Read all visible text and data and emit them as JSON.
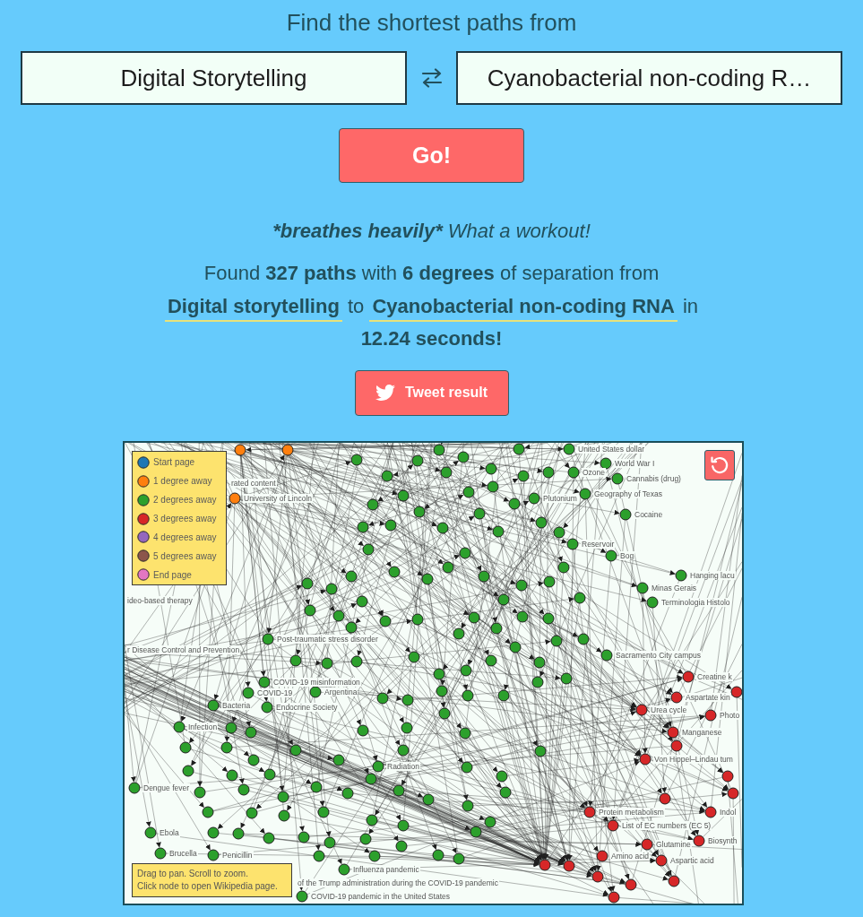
{
  "heading": "Find the shortest paths from",
  "search": {
    "source": {
      "value": "Digital Storytelling"
    },
    "target": {
      "value": "Cyanobacterial non-coding R…"
    }
  },
  "go_button": "Go!",
  "status": {
    "exclamation": "*breathes heavily*",
    "message": "What a workout!"
  },
  "result": {
    "intro": "Found **327 paths** with **6 degrees** of separation from",
    "source_link": "Digital storytelling",
    "joiner": "to",
    "target_link": "Cyanobacterial non-coding RNA",
    "outro": "in **12.24 seconds!**"
  },
  "tweet_button": "Tweet result",
  "graph": {
    "legend": [
      {
        "label": "Start page",
        "color": "#1f77b4"
      },
      {
        "label": "1 degree away",
        "color": "#ff7f0e"
      },
      {
        "label": "2 degrees away",
        "color": "#2ca02c"
      },
      {
        "label": "3 degrees away",
        "color": "#d62728"
      },
      {
        "label": "4 degrees away",
        "color": "#9467bd"
      },
      {
        "label": "5 degrees away",
        "color": "#8c564b"
      },
      {
        "label": "End page",
        "color": "#e377c2"
      }
    ],
    "cut_labels": [
      "rated content",
      "ideo-based therapy",
      "r Disease Control and Prevention",
      "of the Trump administration during the COVID-19 pandemic"
    ],
    "nodes": [
      {
        "color": "#ff7f0e"
      },
      {
        "color": "#ff7f0e"
      },
      {
        "label": "University of Lincoln",
        "color": "#ff7f0e"
      },
      {
        "label": "Post-traumatic stress disorder",
        "color": "#2ca02c"
      },
      {
        "label": "COVID-19 misinformation",
        "color": "#2ca02c"
      },
      {
        "label": "COVID-19",
        "color": "#2ca02c"
      },
      {
        "label": "Bacteria",
        "color": "#2ca02c"
      },
      {
        "label": "Endocrine Society",
        "color": "#2ca02c"
      },
      {
        "label": "Argentina",
        "color": "#2ca02c"
      },
      {
        "label": "Infection",
        "color": "#2ca02c"
      },
      {
        "label": "Dengue fever",
        "color": "#2ca02c"
      },
      {
        "label": "Ebola",
        "color": "#2ca02c"
      },
      {
        "label": "Brucella",
        "color": "#2ca02c"
      },
      {
        "label": "Penicillin",
        "color": "#2ca02c"
      },
      {
        "label": "Influenza pandemic",
        "color": "#2ca02c"
      },
      {
        "label": "COVID-19 pandemic in the United States",
        "color": "#2ca02c"
      },
      {
        "label": "United States dollar",
        "color": "#2ca02c"
      },
      {
        "label": "World War I",
        "color": "#2ca02c"
      },
      {
        "label": "Cannabis (drug)",
        "color": "#2ca02c"
      },
      {
        "label": "Geography of Texas",
        "color": "#2ca02c"
      },
      {
        "label": "Cocaine",
        "color": "#2ca02c"
      },
      {
        "label": "Plutonium",
        "color": "#2ca02c"
      },
      {
        "label": "Ozone",
        "color": "#2ca02c"
      },
      {
        "label": "Reservoir",
        "color": "#2ca02c"
      },
      {
        "label": "Bog",
        "color": "#2ca02c"
      },
      {
        "label": "Hanging lacu",
        "color": "#2ca02c"
      },
      {
        "label": "Minas Gerais",
        "color": "#2ca02c"
      },
      {
        "label": "Terminologia Histolo",
        "color": "#2ca02c"
      },
      {
        "label": "Sacramento City campus",
        "color": "#2ca02c"
      },
      {
        "label": "Radiation",
        "color": "#2ca02c"
      },
      {
        "color": "#2ca02c"
      },
      {
        "color": "#2ca02c"
      },
      {
        "color": "#2ca02c"
      },
      {
        "color": "#2ca02c"
      },
      {
        "color": "#2ca02c"
      },
      {
        "color": "#2ca02c"
      },
      {
        "color": "#2ca02c"
      },
      {
        "color": "#2ca02c"
      },
      {
        "color": "#2ca02c"
      },
      {
        "color": "#2ca02c"
      },
      {
        "color": "#2ca02c"
      },
      {
        "color": "#2ca02c"
      },
      {
        "color": "#2ca02c"
      },
      {
        "color": "#2ca02c"
      },
      {
        "color": "#2ca02c"
      },
      {
        "color": "#2ca02c"
      },
      {
        "color": "#2ca02c"
      },
      {
        "color": "#2ca02c"
      },
      {
        "color": "#2ca02c"
      },
      {
        "color": "#2ca02c"
      },
      {
        "color": "#2ca02c"
      },
      {
        "color": "#2ca02c"
      },
      {
        "color": "#2ca02c"
      },
      {
        "color": "#2ca02c"
      },
      {
        "color": "#2ca02c"
      },
      {
        "color": "#2ca02c"
      },
      {
        "color": "#2ca02c"
      },
      {
        "color": "#2ca02c"
      },
      {
        "color": "#2ca02c"
      },
      {
        "color": "#2ca02c"
      },
      {
        "color": "#2ca02c"
      },
      {
        "color": "#2ca02c"
      },
      {
        "color": "#2ca02c"
      },
      {
        "color": "#2ca02c"
      },
      {
        "color": "#2ca02c"
      },
      {
        "color": "#2ca02c"
      },
      {
        "color": "#2ca02c"
      },
      {
        "color": "#2ca02c"
      },
      {
        "color": "#2ca02c"
      },
      {
        "color": "#2ca02c"
      },
      {
        "color": "#2ca02c"
      },
      {
        "color": "#2ca02c"
      },
      {
        "color": "#2ca02c"
      },
      {
        "color": "#2ca02c"
      },
      {
        "color": "#2ca02c"
      },
      {
        "color": "#2ca02c"
      },
      {
        "color": "#2ca02c"
      },
      {
        "color": "#2ca02c"
      },
      {
        "color": "#2ca02c"
      },
      {
        "color": "#2ca02c"
      },
      {
        "color": "#2ca02c"
      },
      {
        "color": "#2ca02c"
      },
      {
        "color": "#2ca02c"
      },
      {
        "color": "#2ca02c"
      },
      {
        "color": "#2ca02c"
      },
      {
        "color": "#2ca02c"
      },
      {
        "color": "#2ca02c"
      },
      {
        "color": "#2ca02c"
      },
      {
        "color": "#2ca02c"
      },
      {
        "color": "#2ca02c"
      },
      {
        "color": "#2ca02c"
      },
      {
        "color": "#2ca02c"
      },
      {
        "color": "#2ca02c"
      },
      {
        "color": "#2ca02c"
      },
      {
        "color": "#2ca02c"
      },
      {
        "color": "#2ca02c"
      },
      {
        "color": "#2ca02c"
      },
      {
        "color": "#2ca02c"
      },
      {
        "color": "#2ca02c"
      },
      {
        "color": "#2ca02c"
      },
      {
        "color": "#2ca02c"
      },
      {
        "color": "#2ca02c"
      },
      {
        "color": "#2ca02c"
      },
      {
        "color": "#2ca02c"
      },
      {
        "color": "#2ca02c"
      },
      {
        "color": "#2ca02c"
      },
      {
        "color": "#2ca02c"
      },
      {
        "color": "#2ca02c"
      },
      {
        "color": "#2ca02c"
      },
      {
        "color": "#2ca02c"
      },
      {
        "color": "#2ca02c"
      },
      {
        "color": "#2ca02c"
      },
      {
        "color": "#2ca02c"
      },
      {
        "color": "#2ca02c"
      },
      {
        "color": "#2ca02c"
      },
      {
        "color": "#2ca02c"
      },
      {
        "color": "#2ca02c"
      },
      {
        "color": "#2ca02c"
      },
      {
        "color": "#2ca02c"
      },
      {
        "color": "#2ca02c"
      },
      {
        "color": "#2ca02c"
      },
      {
        "color": "#2ca02c"
      },
      {
        "color": "#2ca02c"
      },
      {
        "color": "#2ca02c"
      },
      {
        "color": "#2ca02c"
      },
      {
        "color": "#2ca02c"
      },
      {
        "color": "#2ca02c"
      },
      {
        "color": "#2ca02c"
      },
      {
        "color": "#2ca02c"
      },
      {
        "color": "#2ca02c"
      },
      {
        "color": "#2ca02c"
      },
      {
        "color": "#2ca02c"
      },
      {
        "color": "#2ca02c"
      },
      {
        "color": "#2ca02c"
      },
      {
        "color": "#2ca02c"
      },
      {
        "color": "#2ca02c"
      },
      {
        "color": "#2ca02c"
      },
      {
        "color": "#2ca02c"
      },
      {
        "color": "#2ca02c"
      },
      {
        "color": "#2ca02c"
      },
      {
        "color": "#2ca02c"
      },
      {
        "color": "#2ca02c"
      },
      {
        "color": "#2ca02c"
      },
      {
        "label": "Creatine k",
        "color": "#d62728"
      },
      {
        "label": "Aspartate kin",
        "color": "#d62728"
      },
      {
        "label": "Urea cycle",
        "color": "#d62728"
      },
      {
        "label": "Photo",
        "color": "#d62728"
      },
      {
        "label": "Manganese",
        "color": "#d62728"
      },
      {
        "color": "#d62728"
      },
      {
        "label": "Von Hippel–Lindau tum",
        "color": "#d62728"
      },
      {
        "color": "#d62728"
      },
      {
        "color": "#d62728"
      },
      {
        "color": "#d62728"
      },
      {
        "label": "Protein metabolism",
        "color": "#d62728"
      },
      {
        "label": "List of EC numbers (EC 5)",
        "color": "#d62728"
      },
      {
        "label": "Indol",
        "color": "#d62728"
      },
      {
        "label": "Biosynth",
        "color": "#d62728"
      },
      {
        "label": "Glutamine",
        "color": "#d62728"
      },
      {
        "label": "Amino acid",
        "color": "#d62728"
      },
      {
        "label": "Aspartic acid",
        "color": "#d62728"
      },
      {
        "color": "#d62728"
      },
      {
        "color": "#d62728"
      },
      {
        "color": "#d62728"
      },
      {
        "color": "#d62728"
      },
      {
        "color": "#d62728"
      },
      {
        "color": "#d62728"
      },
      {
        "color": "#d62728"
      }
    ],
    "hint": [
      "Drag to pan. Scroll to zoom.",
      "Click node to open Wikipedia page."
    ]
  }
}
